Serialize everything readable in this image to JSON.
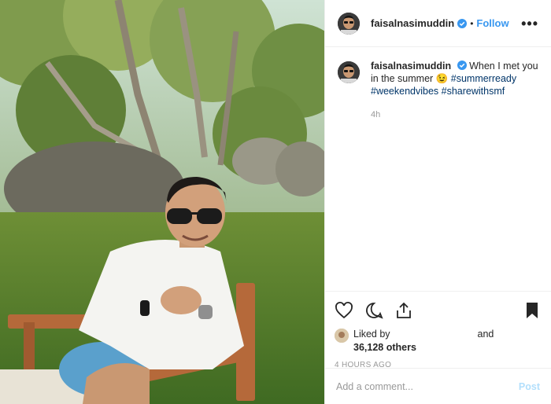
{
  "header": {
    "username": "faisalnasimuddin",
    "separator": "•",
    "follow_label": "Follow",
    "more_label": "•••"
  },
  "caption": {
    "username": "faisalnasimuddin",
    "text": "When I met you in the summer",
    "emoji": "😉",
    "hashtags": [
      "#summerready",
      "#weekendvibes",
      "#sharewithsmf"
    ],
    "time": "4h"
  },
  "likes": {
    "prefix": "Liked by",
    "conjunction": "and",
    "count": "36,128 others"
  },
  "post_time": "4 HOURS AGO",
  "comment": {
    "placeholder": "Add a comment...",
    "post_label": "Post"
  },
  "colors": {
    "accent": "#3897f0",
    "hashtag": "#003569",
    "verified": "#3897f0"
  },
  "icons": [
    "verified-icon",
    "heart-icon",
    "comment-icon",
    "share-icon",
    "bookmark-icon"
  ]
}
